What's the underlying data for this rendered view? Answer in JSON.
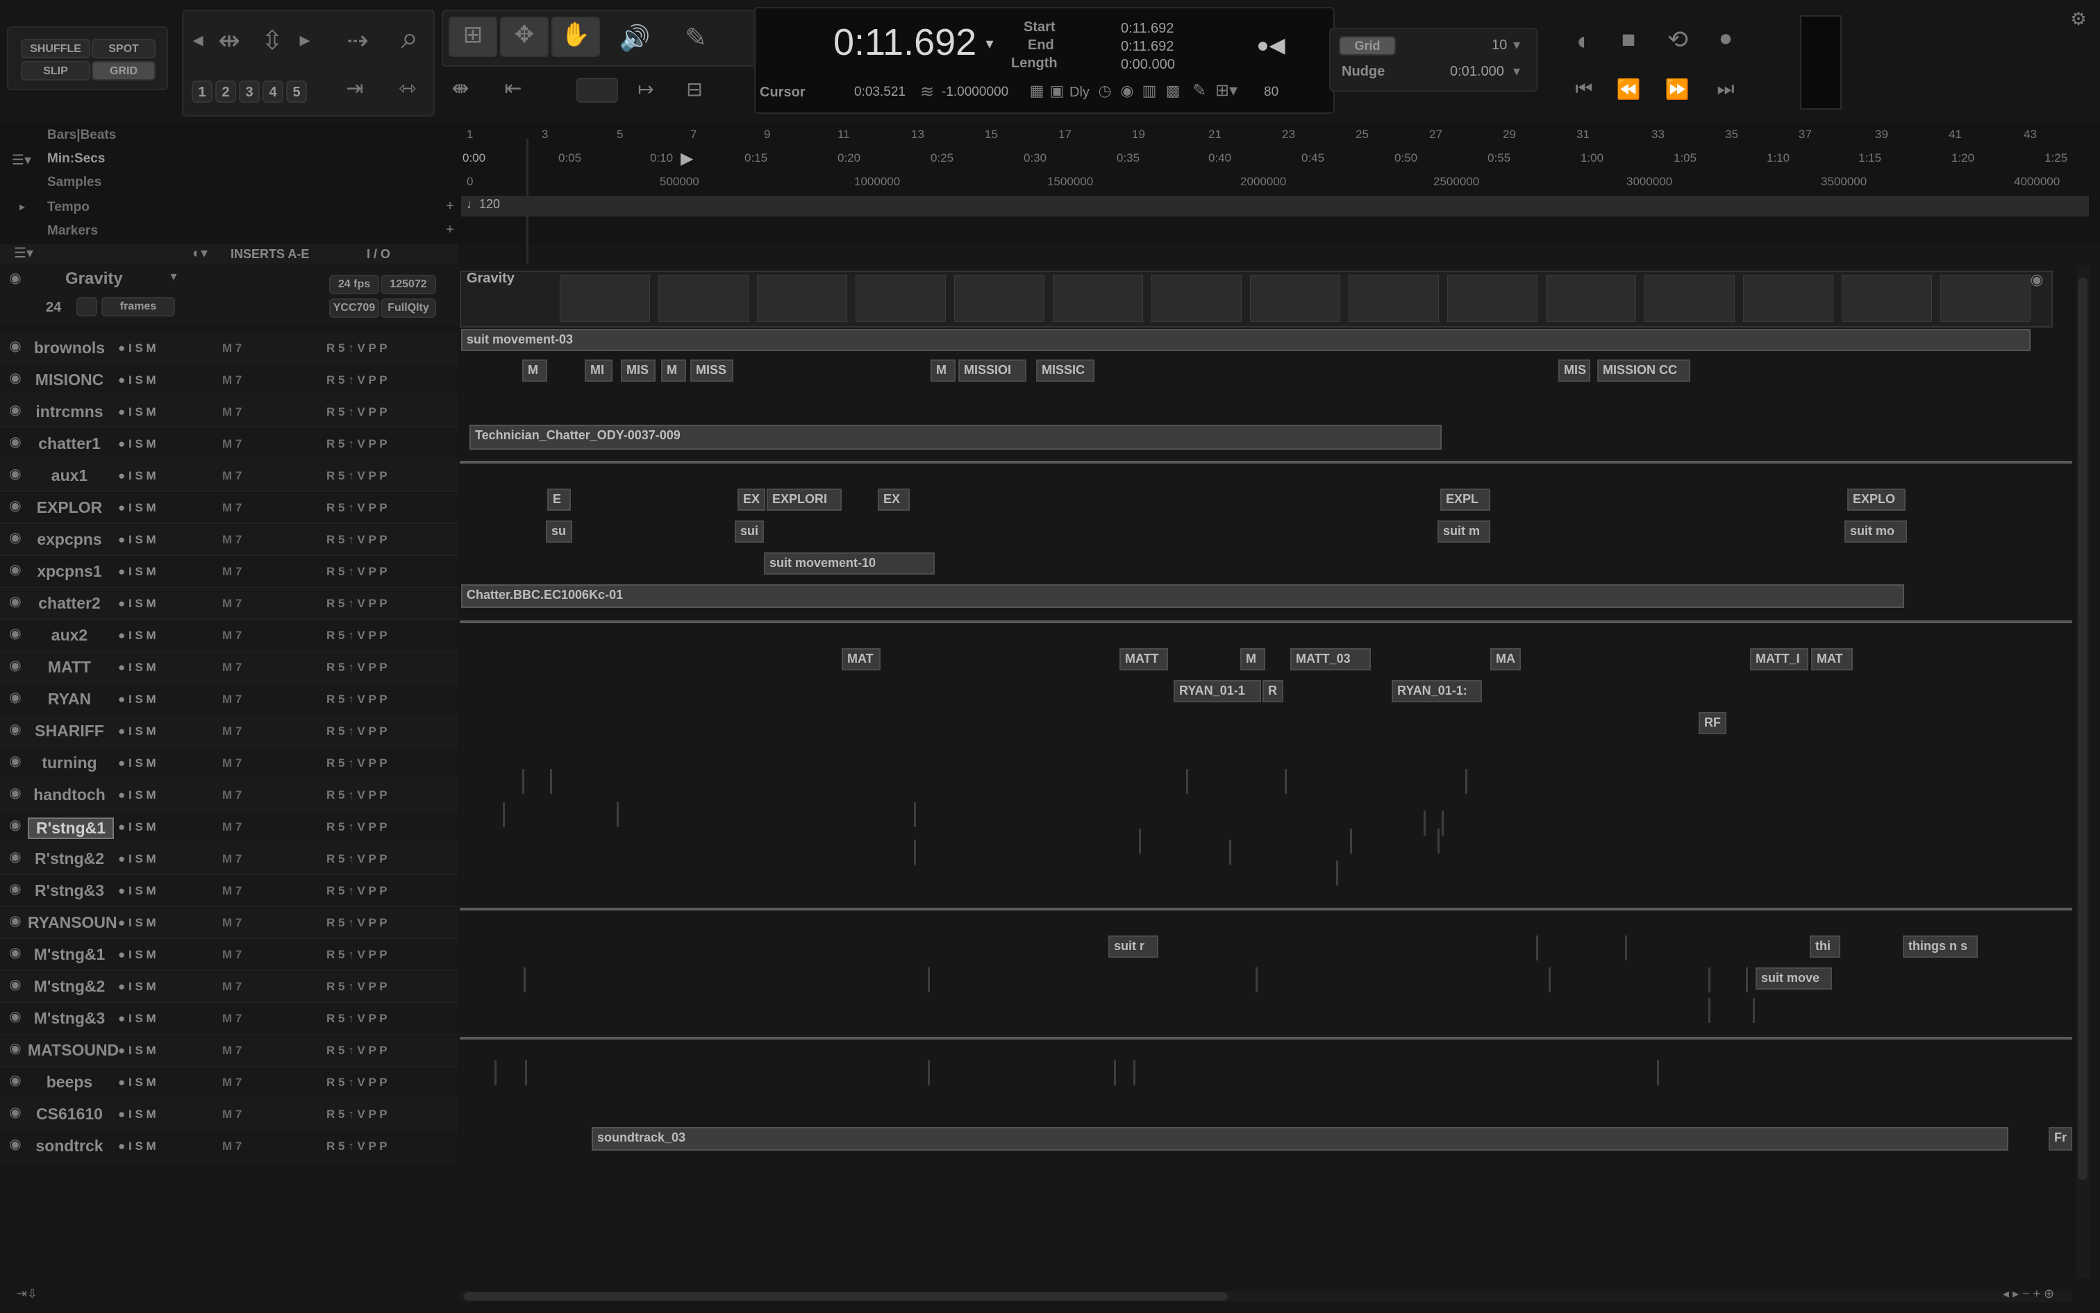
{
  "edit_modes": {
    "shuffle": "SHUFFLE",
    "spot": "SPOT",
    "slip": "SLIP",
    "grid": "GRID"
  },
  "zoom_presets": [
    "1",
    "2",
    "3",
    "4",
    "5"
  ],
  "counter": {
    "main": "0:11.692",
    "start_label": "Start",
    "end_label": "End",
    "length_label": "Length",
    "start": "0:11.692",
    "end": "0:11.692",
    "length": "0:00.000",
    "cursor_label": "Cursor",
    "cursor": "0:03.521",
    "nudge_value": "-1.0000000",
    "dly": "Dly",
    "num": "80"
  },
  "grid": {
    "grid_label": "Grid",
    "grid_value": "10",
    "nudge_label": "Nudge",
    "nudge_value": "0:01.000"
  },
  "rulers": [
    "Bars|Beats",
    "Min:Secs",
    "Samples",
    "Tempo",
    "Markers"
  ],
  "tempo_value": "120",
  "bars": [
    "1",
    "3",
    "5",
    "7",
    "9",
    "11",
    "13",
    "15",
    "17",
    "19",
    "21",
    "23",
    "25",
    "27",
    "29",
    "31",
    "33",
    "35",
    "37",
    "39",
    "41",
    "43"
  ],
  "minsecs": [
    "0:00",
    "0:05",
    "0:10",
    "0:15",
    "0:20",
    "0:25",
    "0:30",
    "0:35",
    "0:40",
    "0:45",
    "0:50",
    "0:55",
    "1:00",
    "1:05",
    "1:10",
    "1:15",
    "1:20",
    "1:25"
  ],
  "samples": [
    "0",
    "500000",
    "1000000",
    "1500000",
    "2000000",
    "2500000",
    "3000000",
    "3500000",
    "4000000"
  ],
  "headers": {
    "inserts": "INSERTS A-E",
    "io": "I / O"
  },
  "video": {
    "track": "Gravity",
    "fps": "24 fps",
    "samples": "125072",
    "codec": "YCC709",
    "quality": "FullQlty",
    "frames": "frames",
    "frame_num": "24",
    "clip": "Gravity"
  },
  "tracks": [
    "brownols",
    "MISIONC",
    "intrcmns",
    "chatter1",
    "aux1",
    "EXPLOR",
    "expcpns",
    "xpcpns1",
    "chatter2",
    "aux2",
    "MATT",
    "RYAN",
    "SHARIFF",
    "turning",
    "handtoch",
    "R'stng&1",
    "R'stng&2",
    "R'stng&3",
    "RYANSOUN",
    "M'stng&1",
    "M'stng&2",
    "M'stng&3",
    "MATSOUND",
    "beeps",
    "CS61610",
    "sondtrck"
  ],
  "clips": {
    "c1": "suit movement-03",
    "c2": "Technician_Chatter_ODY-0037-009",
    "c3": "suit movement-10",
    "c4": "Chatter.BBC.EC1006Kc-01",
    "c5": "soundtrack_03",
    "m1": "M",
    "m2": "MI",
    "m3": "MIS",
    "m4": "M",
    "m5": "MISS",
    "m6": "M",
    "m7": "MISSIOI",
    "m8": "MISSIC",
    "m9": "MIS",
    "m10": "MISSION CC",
    "e1": "E",
    "e2": "EX",
    "e3": "EXPLORI",
    "e4": "EX",
    "e5": "EXPL",
    "e6": "EXPLO",
    "s1": "su",
    "s2": "sui",
    "s3": "suit m",
    "s4": "suit mo",
    "t1": "MAT",
    "t2": "MATT",
    "t3": "M",
    "t4": "MATT_03",
    "t5": "MA",
    "t6": "MATT_I",
    "t7": "MAT",
    "r1": "RYAN_01-1",
    "r2": "R",
    "r3": "RYAN_01-1:",
    "rf": "RF",
    "w1": "suit r",
    "w2": "thi",
    "w3": "things n s",
    "w4": "suit move",
    "w5": "Fr"
  }
}
